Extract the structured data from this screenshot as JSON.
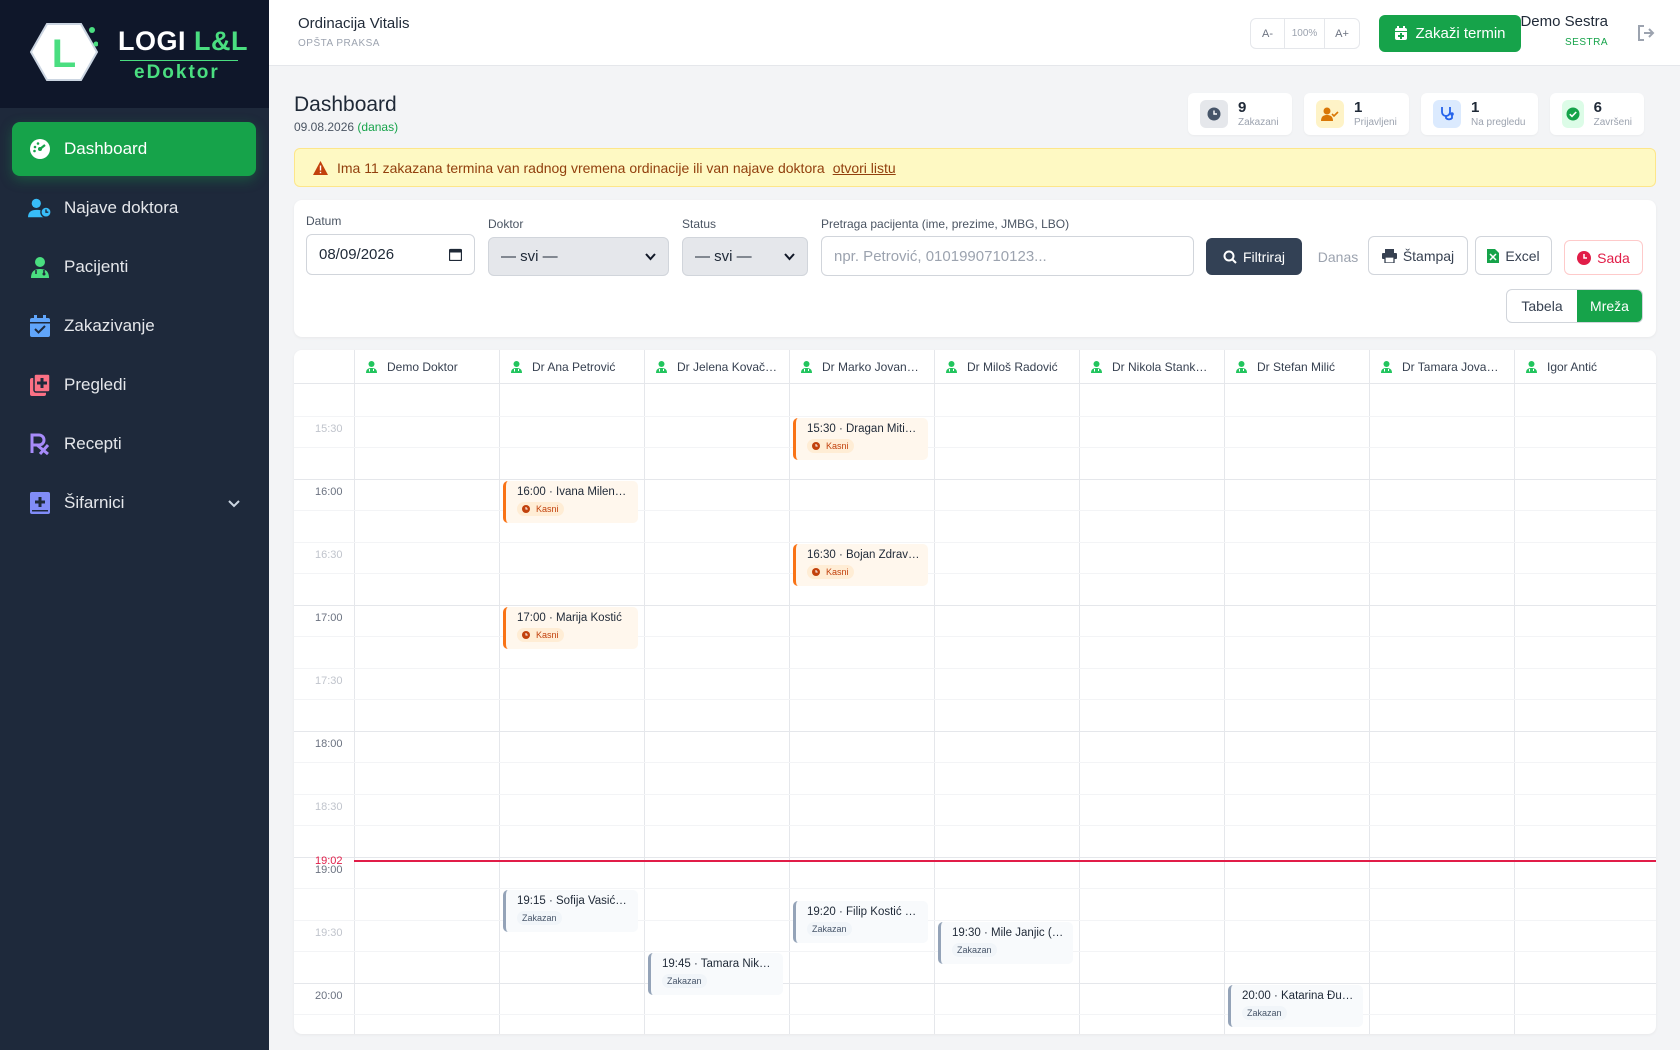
{
  "brand": {
    "logo_letter": "L",
    "line1_a": "LOGI ",
    "line1_b": "L&L",
    "line2": "eDoktor"
  },
  "sidebar": {
    "items": [
      {
        "label": "Dashboard",
        "icon": "gauge-icon",
        "active": true
      },
      {
        "label": "Najave doktora",
        "icon": "user-clock-icon"
      },
      {
        "label": "Pacijenti",
        "icon": "user-doctor-icon"
      },
      {
        "label": "Zakazivanje",
        "icon": "calendar-check-icon"
      },
      {
        "label": "Pregledi",
        "icon": "notes-medical-icon"
      },
      {
        "label": "Recepti",
        "icon": "prescription-icon"
      },
      {
        "label": "Šifarnici",
        "icon": "book-medical-icon",
        "chevron": true
      }
    ]
  },
  "header": {
    "clinic_name": "Ordinacija Vitalis",
    "clinic_type": "OPŠTA PRAKSA",
    "zoom_minus": "A-",
    "zoom_value": "100%",
    "zoom_plus": "A+",
    "schedule_button": "Zakaži termin",
    "user_name": "Demo Sestra",
    "user_role": "SESTRA"
  },
  "page": {
    "title": "Dashboard",
    "date": "09.08.2026",
    "today": "(danas)"
  },
  "stats": [
    {
      "value": "9",
      "label": "Zakazani",
      "color": "#475569",
      "bg": "#e5e7eb"
    },
    {
      "value": "1",
      "label": "Prijavljeni",
      "color": "#d97706",
      "bg": "#fef3c7"
    },
    {
      "value": "1",
      "label": "Na pregledu",
      "color": "#2563eb",
      "bg": "#dbeafe"
    },
    {
      "value": "6",
      "label": "Završeni",
      "color": "#16a34a",
      "bg": "#dcfce7"
    }
  ],
  "alert": {
    "text": "Ima 11 zakazana termina van radnog vremena ordinacije ili van najave doktora",
    "link": "otvori listu"
  },
  "filters": {
    "date_label": "Datum",
    "date_value": "08/09/2026",
    "doctor_label": "Doktor",
    "doctor_value": "— svi —",
    "status_label": "Status",
    "status_value": "— svi —",
    "search_label": "Pretraga pacijenta (ime, prezime, JMBG, LBO)",
    "search_placeholder": "npr. Petrović, 0101990710123...",
    "filter_button": "Filtriraj",
    "today_button": "Danas",
    "print_button": "Štampaj",
    "excel_button": "Excel",
    "now_button": "Sada",
    "view_table": "Tabela",
    "view_grid": "Mreža"
  },
  "grid": {
    "doctors": [
      "Demo Doktor",
      "Dr Ana Petrović",
      "Dr Jelena Kovač…",
      "Dr Marko Jovan…",
      "Dr Miloš Radović",
      "Dr Nikola Stank…",
      "Dr Stefan Milić",
      "Dr Tamara Jova…",
      "Igor Antić"
    ],
    "times": [
      "15:30",
      "16:00",
      "16:30",
      "17:00",
      "17:30",
      "18:00",
      "18:30",
      "19:00",
      "19:30",
      "20:00"
    ],
    "now_label": "19:02",
    "appointments": [
      {
        "col": 3,
        "time": "15:30",
        "title": "15:30 · Dragan Miti…",
        "status": "Kasni",
        "type": "late"
      },
      {
        "col": 1,
        "time": "16:00",
        "title": "16:00 · Ivana Milen…",
        "status": "Kasni",
        "type": "late"
      },
      {
        "col": 3,
        "time": "16:30",
        "title": "16:30 · Bojan Zdrav…",
        "status": "Kasni",
        "type": "late"
      },
      {
        "col": 1,
        "time": "17:00",
        "title": "17:00 · Marija Kostić",
        "status": "Kasni",
        "type": "late"
      },
      {
        "col": 1,
        "time": "19:15",
        "title": "19:15 · Sofija Vasić…",
        "status": "Zakazan",
        "type": "sched"
      },
      {
        "col": 3,
        "time": "19:20",
        "title": "19:20 · Filip Kostić …",
        "status": "Zakazan",
        "type": "sched"
      },
      {
        "col": 4,
        "time": "19:30",
        "title": "19:30 · Mile Janjic (…",
        "status": "Zakazan",
        "type": "sched"
      },
      {
        "col": 2,
        "time": "19:45",
        "title": "19:45 · Tamara Nik…",
        "status": "Zakazan",
        "type": "sched"
      },
      {
        "col": 6,
        "time": "20:00",
        "title": "20:00 · Katarina Đu…",
        "status": "Zakazan",
        "type": "sched"
      }
    ]
  }
}
